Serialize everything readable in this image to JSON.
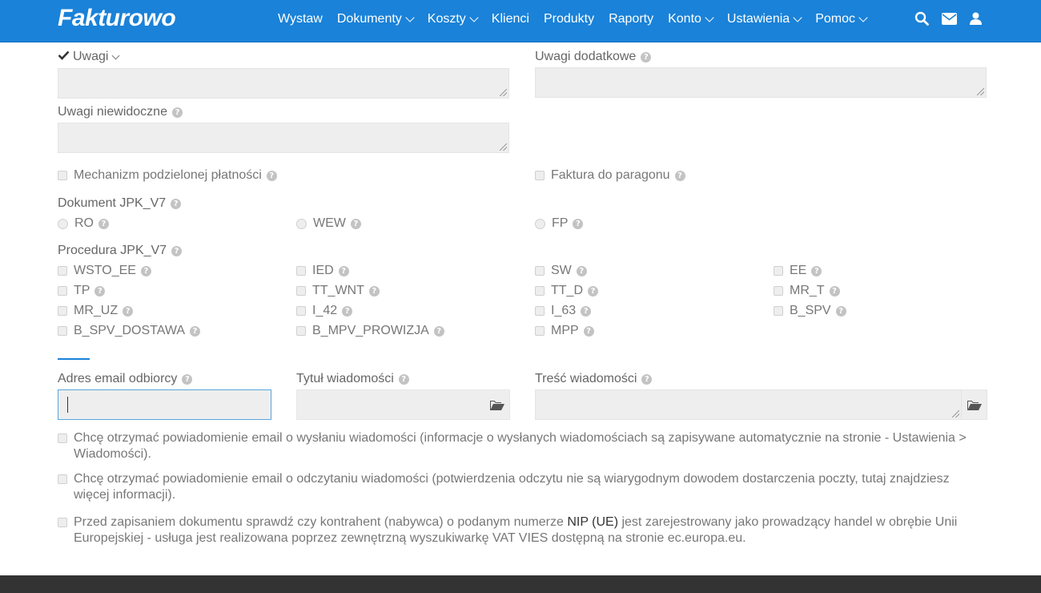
{
  "brand": "Fakturowo",
  "nav": [
    {
      "label": "Wystaw",
      "dropdown": false
    },
    {
      "label": "Dokumenty",
      "dropdown": true
    },
    {
      "label": "Koszty",
      "dropdown": true
    },
    {
      "label": "Klienci",
      "dropdown": false
    },
    {
      "label": "Produkty",
      "dropdown": false
    },
    {
      "label": "Raporty",
      "dropdown": false
    },
    {
      "label": "Konto",
      "dropdown": true
    },
    {
      "label": "Ustawienia",
      "dropdown": true
    },
    {
      "label": "Pomoc",
      "dropdown": true
    }
  ],
  "nav_icons": [
    "search-icon",
    "envelope-icon",
    "user-icon"
  ],
  "form": {
    "uwagi_label": "Uwagi",
    "uwagi_dodatkowe_label": "Uwagi dodatkowe",
    "uwagi_niewidoczne_label": "Uwagi niewidoczne",
    "split_payment_label": "Mechanizm podzielonej płatności",
    "faktura_paragon_label": "Faktura do paragonu",
    "jpk_dokument_label": "Dokument JPK_V7",
    "jpk_dokument_options": [
      "RO",
      "WEW",
      "FP"
    ],
    "jpk_procedura_label": "Procedura JPK_V7",
    "jpk_procedura_options": [
      [
        "WSTO_EE",
        "IED",
        "SW",
        "EE"
      ],
      [
        "TP",
        "TT_WNT",
        "TT_D",
        "MR_T"
      ],
      [
        "MR_UZ",
        "I_42",
        "I_63",
        "B_SPV"
      ],
      [
        "B_SPV_DOSTAWA",
        "B_MPV_PROWIZJA",
        "MPP"
      ]
    ],
    "email_label": "Adres email odbiorcy",
    "email_value": "",
    "subject_label": "Tytuł wiadomości",
    "body_label": "Treść wiadomości",
    "notify_sent": "Chcę otrzymać powiadomienie email o wysłaniu wiadomości (informacje o wysłanych wiadomościach są zapisywane automatycznie na stronie - Ustawienia > Wiadomości).",
    "notify_read": "Chcę otrzymać powiadomienie email o odczytaniu wiadomości (potwierdzenia odczytu nie są wiarygodnym dowodem dostarczenia poczty, tutaj znajdziesz więcej informacji).",
    "vies_before": "Przed zapisaniem dokumentu sprawdź czy kontrahent (nabywca) o podanym numerze ",
    "vies_strong": "NIP (UE)",
    "vies_after": " jest zarejestrowany jako prowadzący handel w obrębie Unii Europejskiej - usługa jest realizowana poprzez zewnętrzną wyszukiwarkę VAT VIES dostępną na stronie ec.europa.eu."
  },
  "colors": {
    "accent": "#1a82d8",
    "footer": "#333333",
    "field_bg": "#eeeeee"
  }
}
